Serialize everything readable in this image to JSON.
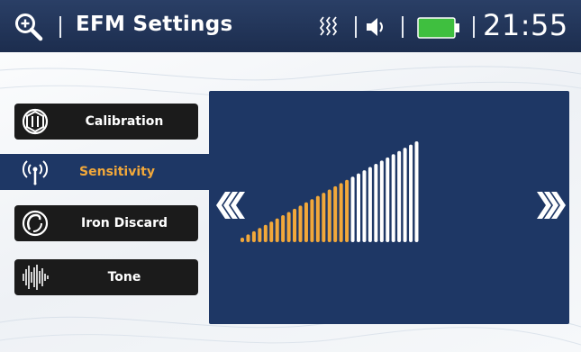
{
  "header": {
    "title": "EFM  Settings",
    "time": "21:55",
    "icons": [
      "search-icon",
      "vibration-icon",
      "speaker-icon",
      "battery-icon"
    ],
    "battery_color": "#3fbf3f"
  },
  "menu": {
    "items": [
      {
        "label": "Calibration",
        "icon": "calibration-icon"
      },
      {
        "label": "Sensitivity",
        "icon": "sensitivity-icon",
        "active": true
      },
      {
        "label": "Iron Discard",
        "icon": "iron-discard-icon"
      },
      {
        "label": "Tone",
        "icon": "tone-icon"
      }
    ]
  },
  "sensitivity": {
    "total_bars": 31,
    "level": 19,
    "active_color": "#f2a83a",
    "inactive_color": "#ffffff",
    "decrease_icon": "chevron-left-icon",
    "increase_icon": "chevron-right-icon"
  }
}
